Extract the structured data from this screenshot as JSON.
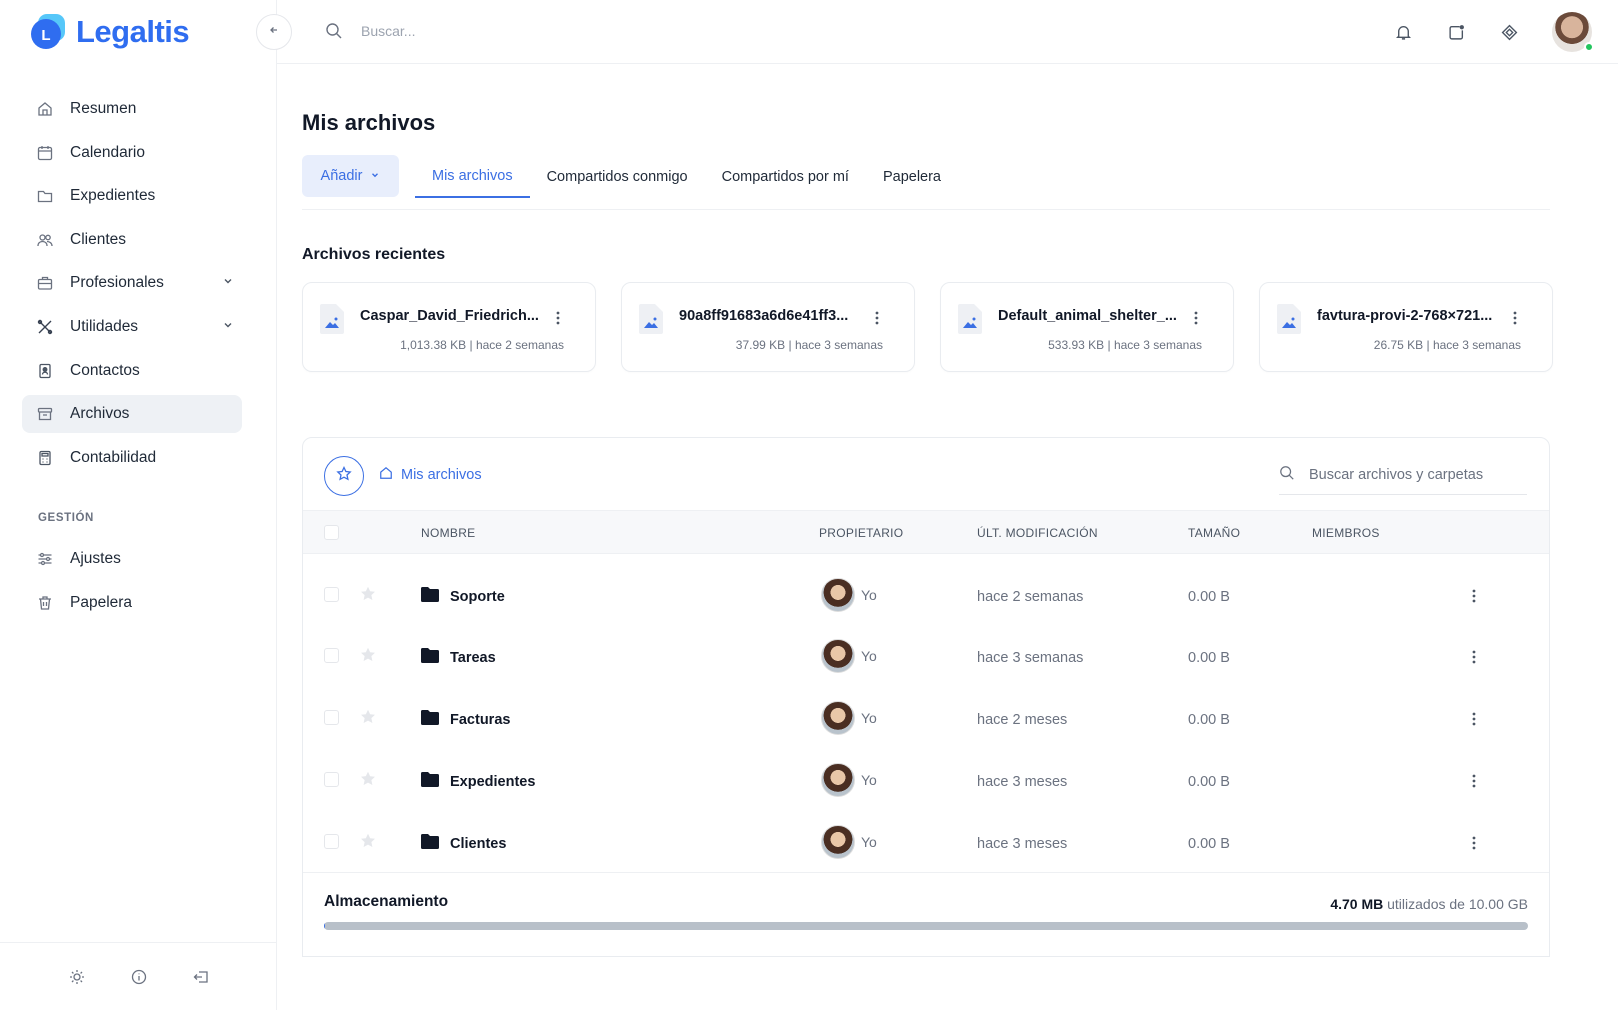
{
  "app": {
    "brand": "Legaltis",
    "logo_letter": "L",
    "accent": "#3b6fe3"
  },
  "sidebar": {
    "items": [
      {
        "label": "Resumen",
        "icon": "home-icon"
      },
      {
        "label": "Calendario",
        "icon": "calendar-icon"
      },
      {
        "label": "Expedientes",
        "icon": "folder-icon"
      },
      {
        "label": "Clientes",
        "icon": "users-icon"
      },
      {
        "label": "Profesionales",
        "icon": "briefcase-icon",
        "expandable": true
      },
      {
        "label": "Utilidades",
        "icon": "tools-icon",
        "expandable": true
      },
      {
        "label": "Contactos",
        "icon": "contact-icon"
      },
      {
        "label": "Archivos",
        "icon": "archive-icon",
        "active": true
      },
      {
        "label": "Contabilidad",
        "icon": "calculator-icon"
      }
    ],
    "section_label": "GESTIÓN",
    "section_items": [
      {
        "label": "Ajustes",
        "icon": "sliders-icon"
      },
      {
        "label": "Papelera",
        "icon": "trash-icon"
      }
    ]
  },
  "topbar": {
    "search_placeholder": "Buscar..."
  },
  "page": {
    "title": "Mis archivos",
    "add_label": "Añadir",
    "tabs": [
      {
        "label": "Mis archivos",
        "active": true
      },
      {
        "label": "Compartidos conmigo"
      },
      {
        "label": "Compartidos por mí"
      },
      {
        "label": "Papelera"
      }
    ]
  },
  "recent": {
    "title": "Archivos recientes",
    "files": [
      {
        "name": "Caspar_David_Friedrich...",
        "size": "1,013.38 KB",
        "time": "hace 2 semanas"
      },
      {
        "name": "90a8ff91683a6d6e41ff3...",
        "size": "37.99 KB",
        "time": "hace 3 semanas"
      },
      {
        "name": "Default_animal_shelter_...",
        "size": "533.93 KB",
        "time": "hace 3 semanas"
      },
      {
        "name": "favtura-provi-2-768×721...",
        "size": "26.75 KB",
        "time": "hace 3 semanas"
      }
    ]
  },
  "browser": {
    "breadcrumb": "Mis archivos",
    "search_placeholder": "Buscar archivos y carpetas",
    "columns": {
      "name": "NOMBRE",
      "owner": "PROPIETARIO",
      "modified": "ÚLT. MODIFICACIÓN",
      "size": "TAMAÑO",
      "members": "MIEMBROS"
    },
    "rows": [
      {
        "name": "Soporte",
        "owner": "Yo",
        "modified": "hace 2 semanas",
        "size": "0.00 B"
      },
      {
        "name": "Tareas",
        "owner": "Yo",
        "modified": "hace 3 semanas",
        "size": "0.00 B"
      },
      {
        "name": "Facturas",
        "owner": "Yo",
        "modified": "hace 2 meses",
        "size": "0.00 B"
      },
      {
        "name": "Expedientes",
        "owner": "Yo",
        "modified": "hace 3 meses",
        "size": "0.00 B"
      },
      {
        "name": "Clientes",
        "owner": "Yo",
        "modified": "hace 3 meses",
        "size": "0.00 B"
      }
    ]
  },
  "storage": {
    "label": "Almacenamiento",
    "used": "4.70 MB",
    "suffix": "utilizados de 10.00 GB",
    "used_fraction": 0.00047
  }
}
